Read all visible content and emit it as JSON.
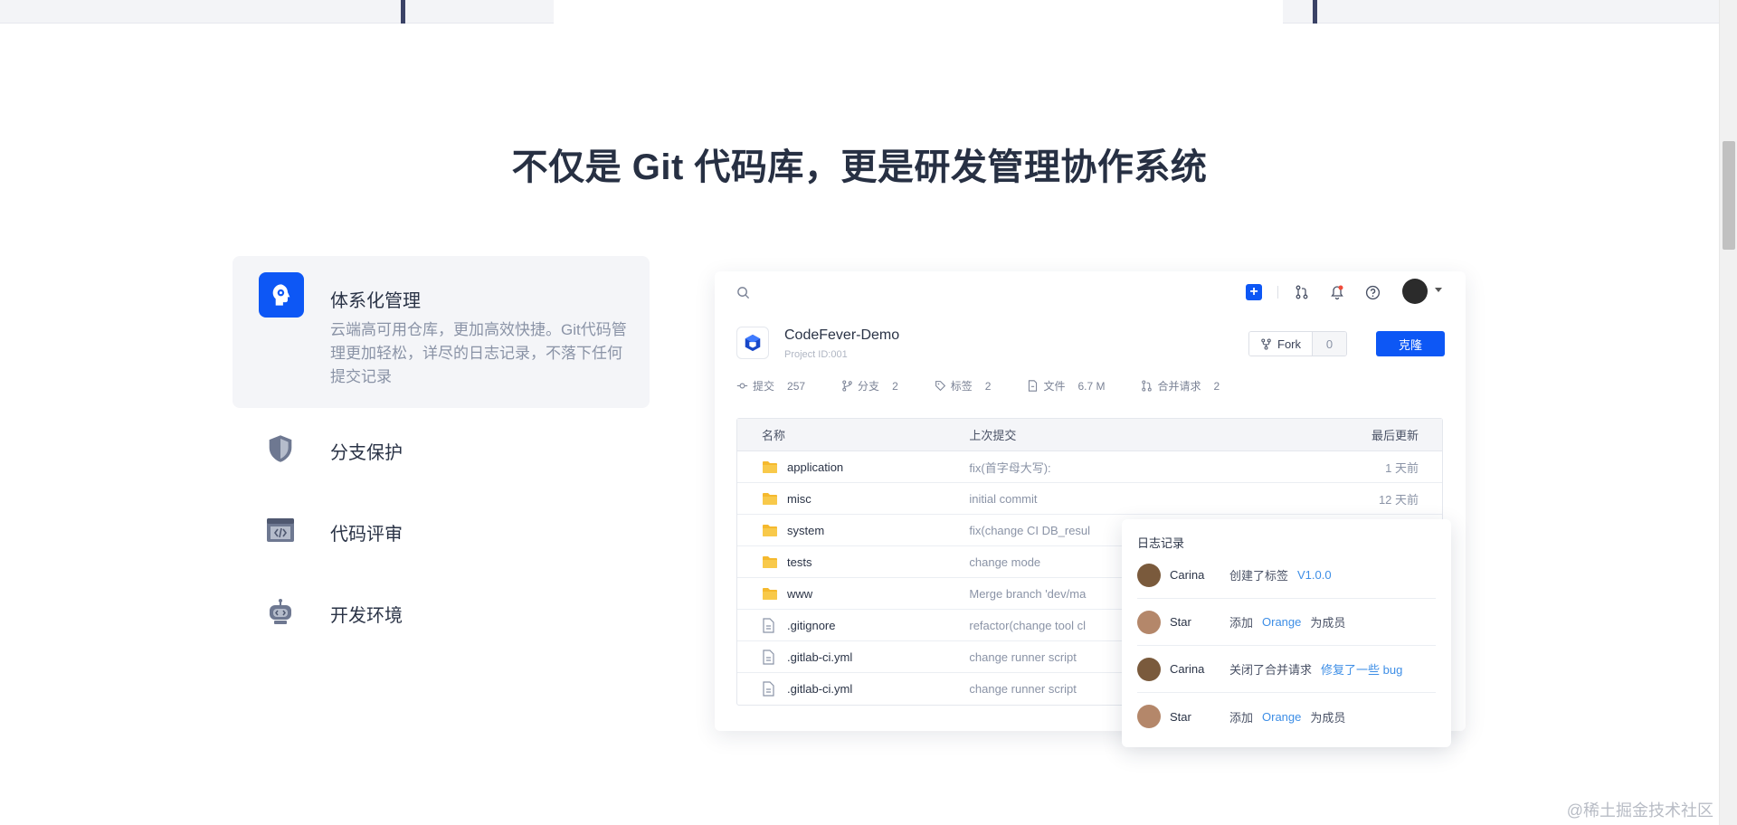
{
  "headline": "不仅是 Git 代码库，更是研发管理协作系统",
  "features": [
    {
      "title": "体系化管理",
      "desc": "云端高可用仓库，更加高效快捷。Git代码管理更加轻松，详尽的日志记录，不落下任何提交记录",
      "icon": "brain-gear-icon"
    },
    {
      "title": "分支保护",
      "icon": "shield-icon"
    },
    {
      "title": "代码评审",
      "icon": "code-window-icon"
    },
    {
      "title": "开发环境",
      "icon": "robot-environment-icon"
    }
  ],
  "repo": {
    "name": "CodeFever-Demo",
    "project_id": "Project ID:001",
    "fork_label": "Fork",
    "fork_count": "0",
    "clone_label": "克隆",
    "stats": [
      {
        "label": "提交",
        "value": "257",
        "icon": "commit-icon"
      },
      {
        "label": "分支",
        "value": "2",
        "icon": "branch-icon"
      },
      {
        "label": "标签",
        "value": "2",
        "icon": "tag-icon"
      },
      {
        "label": "文件",
        "value": "6.7 M",
        "icon": "file-icon"
      },
      {
        "label": "合并请求",
        "value": "2",
        "icon": "merge-request-icon"
      }
    ]
  },
  "table": {
    "headers": {
      "name": "名称",
      "commit": "上次提交",
      "updated": "最后更新"
    },
    "rows": [
      {
        "name": "application",
        "commit": "fix(首字母大写):",
        "time": "1 天前",
        "type": "folder"
      },
      {
        "name": "misc",
        "commit": "initial commit",
        "time": "12 天前",
        "type": "folder"
      },
      {
        "name": "system",
        "commit": "fix(change CI DB_resul",
        "time": "",
        "type": "folder"
      },
      {
        "name": "tests",
        "commit": "change mode",
        "time": "",
        "type": "folder"
      },
      {
        "name": "www",
        "commit": "Merge branch 'dev/ma",
        "time": "",
        "type": "folder"
      },
      {
        "name": ".gitignore",
        "commit": "refactor(change tool cl",
        "time": "",
        "type": "file"
      },
      {
        "name": ".gitlab-ci.yml",
        "commit": "change runner script",
        "time": "",
        "type": "file"
      },
      {
        "name": ".gitlab-ci.yml",
        "commit": "change runner script",
        "time": "",
        "type": "file"
      }
    ]
  },
  "log": {
    "title": "日志记录",
    "items": [
      {
        "user": "Carina",
        "action": "创建了标签",
        "link": "V1.0.0",
        "tail": ""
      },
      {
        "user": "Star",
        "action": "添加",
        "link": "Orange",
        "tail": "为成员"
      },
      {
        "user": "Carina",
        "action": "关闭了合并请求",
        "link": "修复了一些 bug",
        "tail": ""
      },
      {
        "user": "Star",
        "action": "添加",
        "link": "Orange",
        "tail": "为成员"
      }
    ]
  },
  "watermark": "@稀土掘金技术社区",
  "colors": {
    "accent": "#0d57f5",
    "link": "#3d8ee6",
    "folder": "#f5b92e"
  }
}
